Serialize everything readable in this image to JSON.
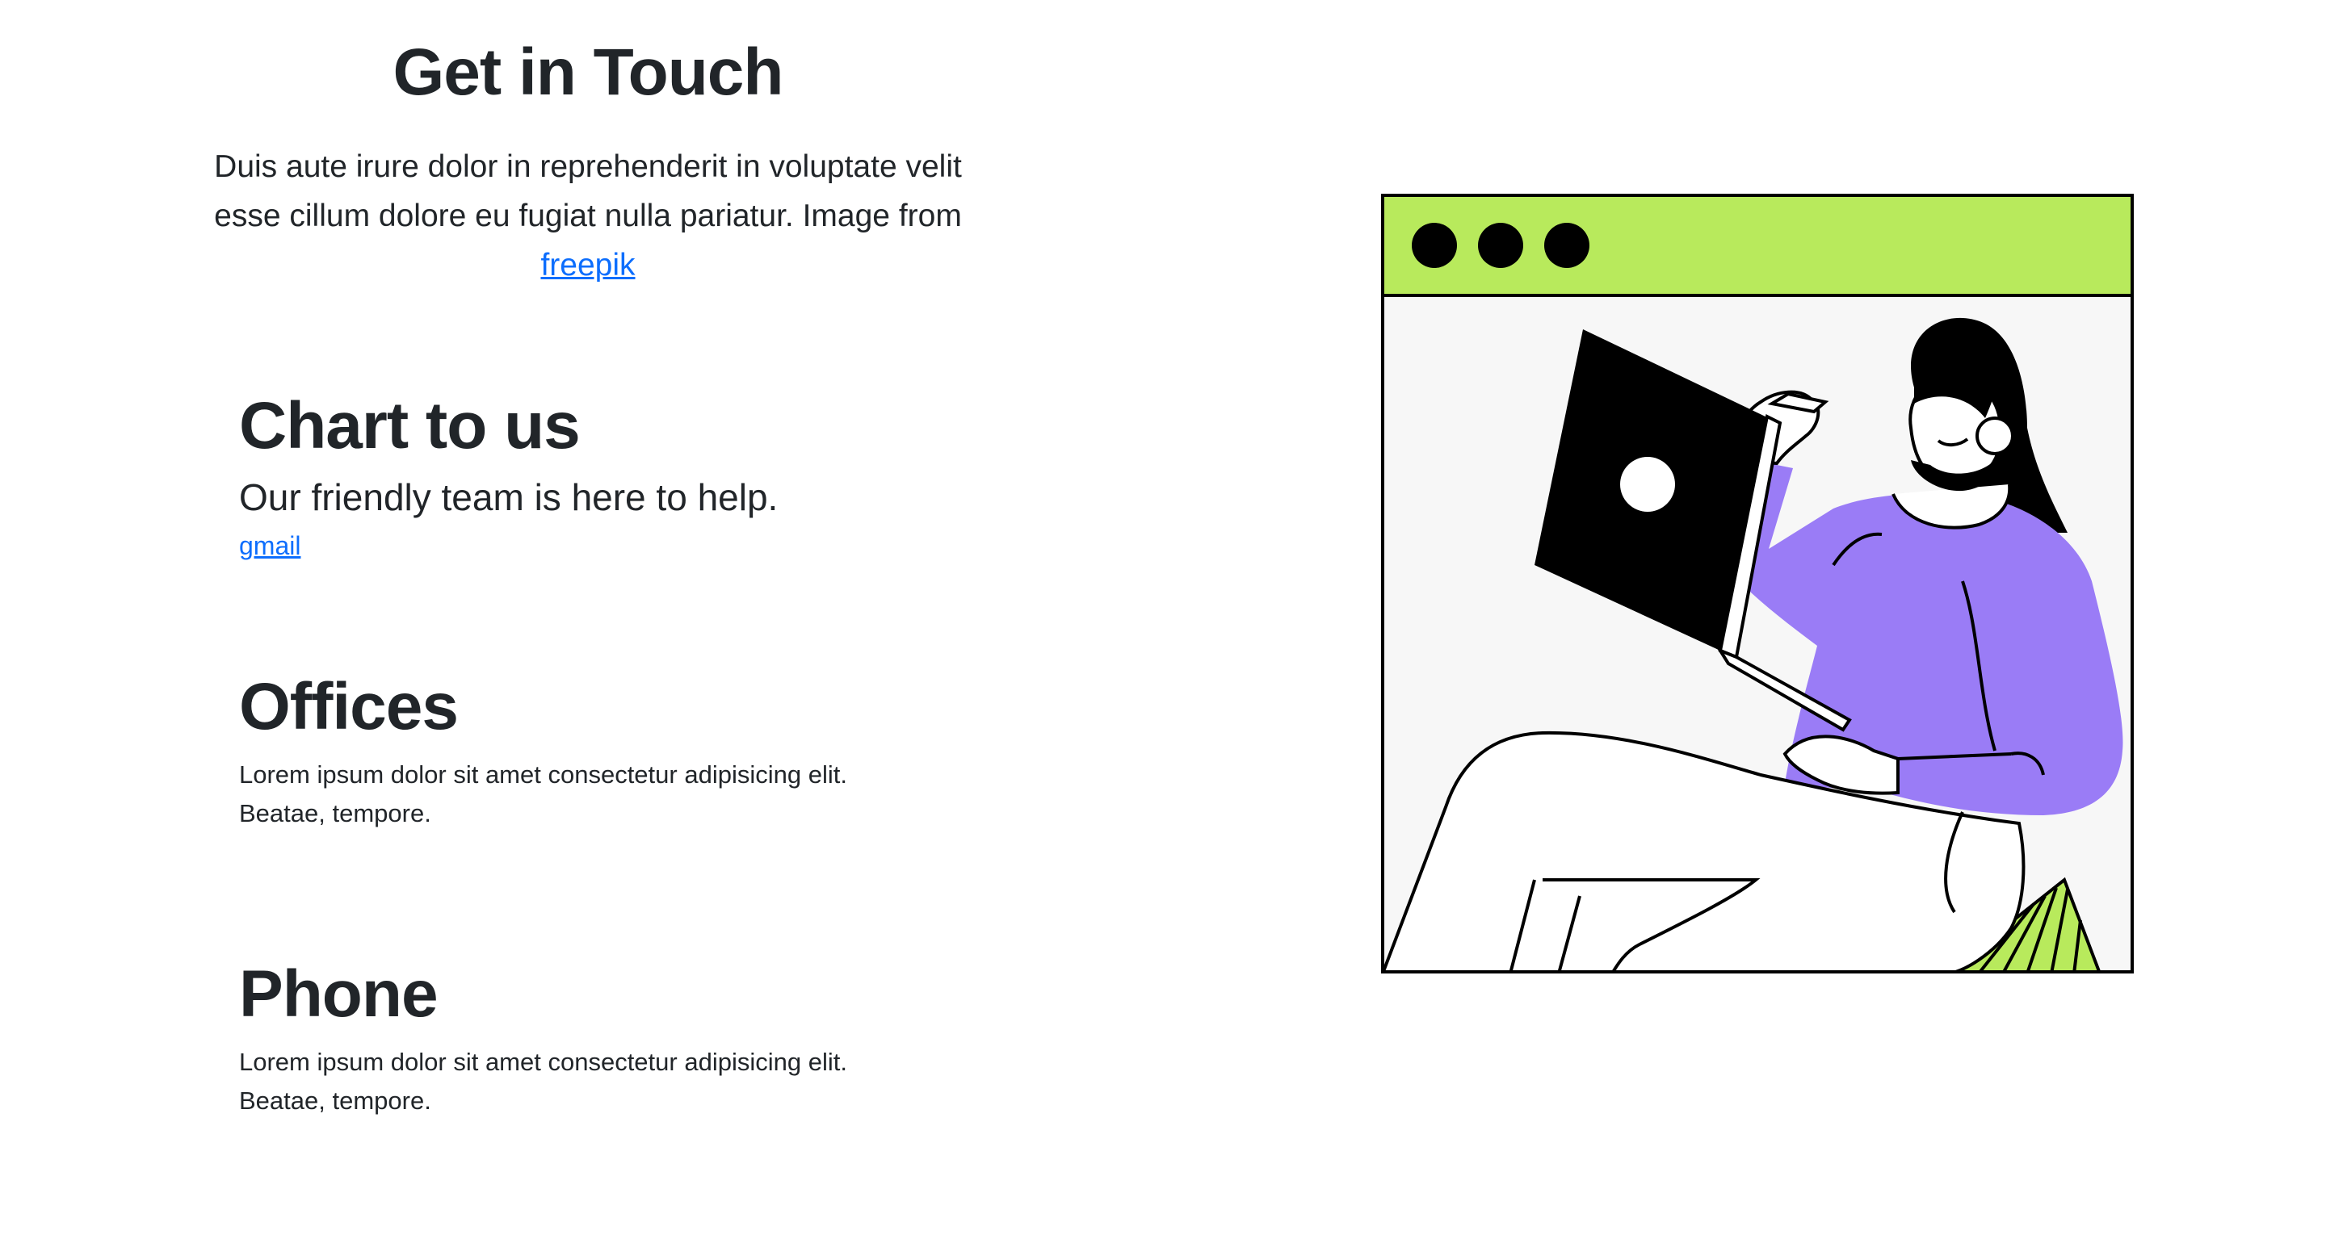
{
  "header": {
    "title": "Get in Touch",
    "description": "Duis aute irure dolor in reprehenderit in voluptate velit esse cillum dolore eu fugiat nulla pariatur. Image from",
    "credit_link": "freepik"
  },
  "chat": {
    "title": "Chart to us",
    "subtitle": "Our friendly team is here to help.",
    "email_link": "gmail"
  },
  "offices": {
    "title": "Offices",
    "text_line1": "Lorem ipsum dolor sit amet consectetur adipisicing elit.",
    "text_line2": "Beatae, tempore."
  },
  "phone": {
    "title": "Phone",
    "text_line1": "Lorem ipsum dolor sit amet consectetur adipisicing elit.",
    "text_line2": "Beatae, tempore."
  },
  "illustration": {
    "name": "woman-with-laptop-illustration",
    "colors": {
      "titlebar": "#b8ea5c",
      "sweater": "#9a7cf6",
      "background": "#f7f7f7",
      "outline": "#000000"
    }
  },
  "colors": {
    "text": "#212529",
    "link": "#0d6efd"
  }
}
